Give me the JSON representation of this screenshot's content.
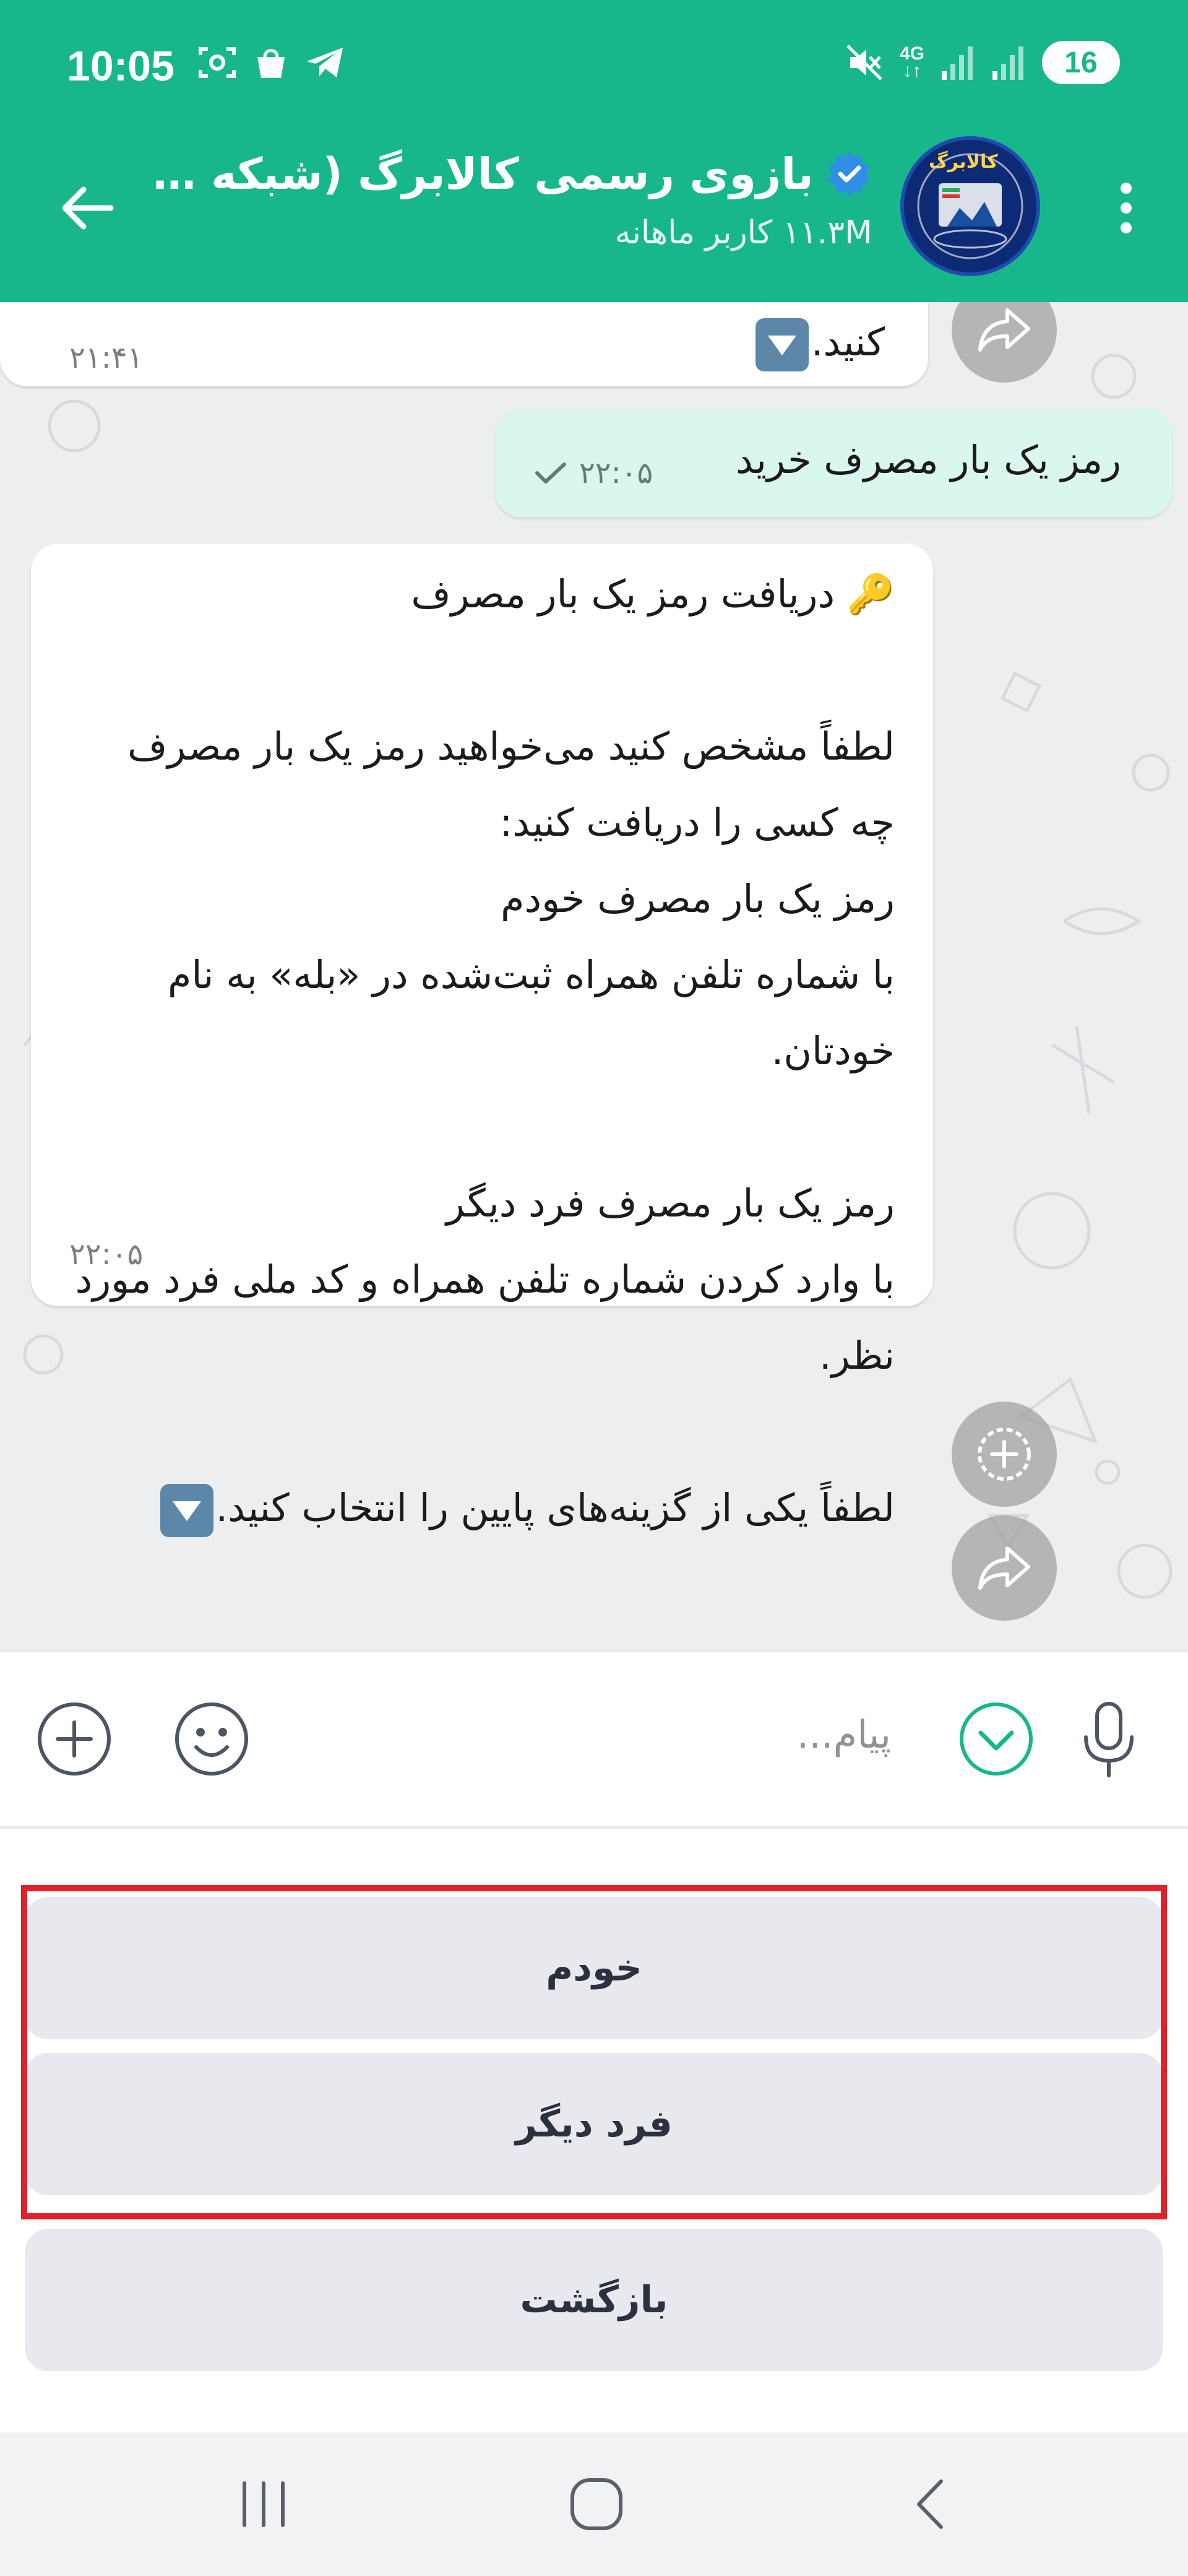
{
  "status_bar": {
    "time": "10:05",
    "network": "4G",
    "battery": "16"
  },
  "header": {
    "title": "بازوی رسمی کالابرگ (شبکه مل...",
    "subtitle": "۱۱.۳M کاربر ماهانه",
    "avatar_text": "کالابرگ"
  },
  "messages": {
    "previous": {
      "text": "کنید.",
      "time": "۲۱:۴۱"
    },
    "outgoing": {
      "text": "رمز یک بار مصرف خرید",
      "time": "۲۲:۰۵"
    },
    "incoming": {
      "lines": [
        "🔑 دریافت رمز یک بار مصرف",
        "",
        "لطفاً مشخص کنید می‌خواهید رمز یک بار مصرف",
        "چه کسی را دریافت کنید:",
        "رمز یک بار مصرف خودم",
        "با شماره تلفن همراه ثبت‌شده در «بله» به نام",
        "خودتان.",
        "",
        "رمز یک بار مصرف فرد دیگر",
        "با وارد کردن شماره تلفن همراه و کد ملی فرد مورد",
        "نظر.",
        "",
        "لطفاً یکی از گزینه‌های پایین را انتخاب کنید."
      ],
      "time": "۲۲:۰۵"
    }
  },
  "input": {
    "placeholder": "پیام..."
  },
  "keyboard": {
    "buttons": [
      "خودم",
      "فرد دیگر",
      "بازگشت"
    ]
  },
  "colors": {
    "brand": "#18b78b",
    "outgoing_bubble": "#d9f7ef",
    "highlight": "#e0202a",
    "keyboard_button": "#e8e9ee"
  }
}
